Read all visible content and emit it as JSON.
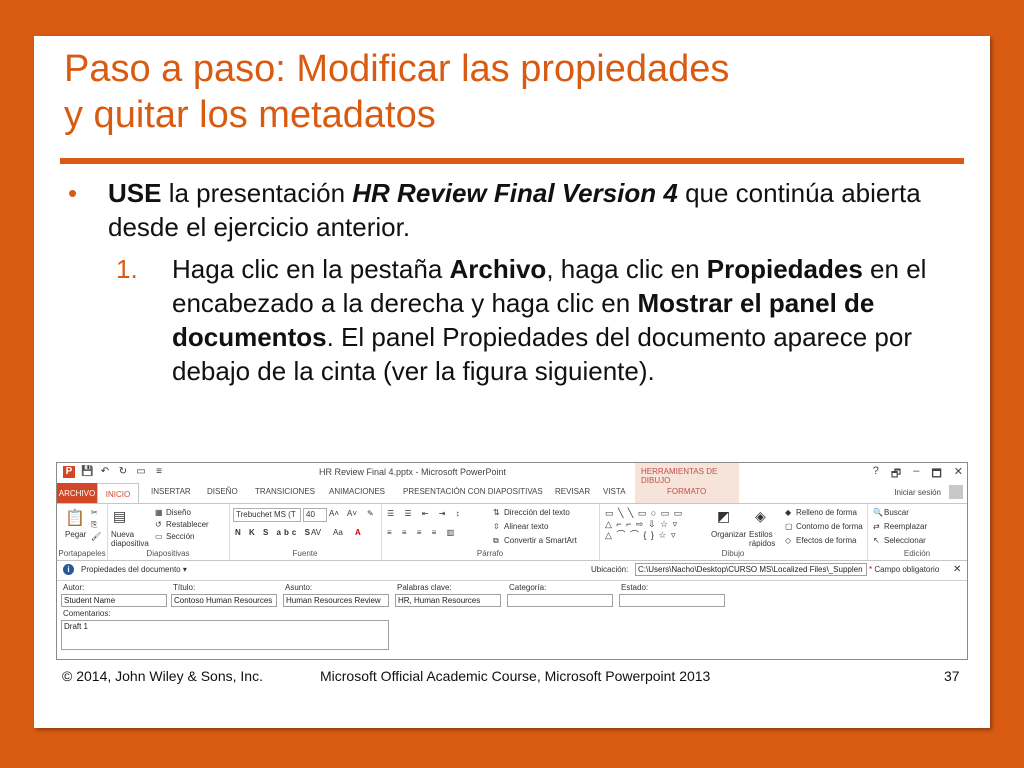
{
  "slide": {
    "title_line1": "Paso a paso: Modificar las propiedades",
    "title_line2": "y quitar los metadatos",
    "bullet": {
      "use": "USE",
      "text1": " la presentación ",
      "doc_name": "HR Review Final Version 4",
      "text2": " que continúa abierta desde el ejercicio anterior."
    },
    "step": {
      "number": "1.",
      "t1": "Haga clic en la pestaña ",
      "b1": "Archivo",
      "t2": ", haga clic en ",
      "b2": "Propiedades",
      "t3": " en el encabezado a la derecha y haga clic en ",
      "b3": "Mostrar el panel de documentos",
      "t4": ". El panel Propiedades del documento aparece por debajo de la cinta (ver la figura siguiente)."
    }
  },
  "screenshot": {
    "window_title": "HR Review Final 4.pptx - Microsoft PowerPoint",
    "context_tab_header": "HERRAMIENTAS DE DIBUJO",
    "window_controls": [
      "?",
      "🗗",
      "–",
      "🗖",
      "✕"
    ],
    "tabs": [
      "ARCHIVO",
      "INICIO",
      "INSERTAR",
      "DISEÑO",
      "TRANSICIONES",
      "ANIMACIONES",
      "PRESENTACIÓN CON DIAPOSITIVAS",
      "REVISAR",
      "VISTA",
      "FORMATO"
    ],
    "signin": "Iniciar sesión",
    "ribbon": {
      "portapapeles": {
        "label": "Portapapeles",
        "pegar": "Pegar"
      },
      "diapositivas": {
        "label": "Diapositivas",
        "nueva": "Nueva diapositiva",
        "diseno": "Diseño",
        "restablecer": "Restablecer",
        "seccion": "Sección"
      },
      "fuente": {
        "label": "Fuente",
        "font_name": "Trebuchet MS (T",
        "font_size": "40",
        "styles": "N K S abc S",
        "spacing": "AV",
        "case": "Aa",
        "color": "A"
      },
      "parrafo": {
        "label": "Párrafo",
        "direccion": "Dirección del texto",
        "alinear": "Alinear texto",
        "smartart": "Convertir a SmartArt"
      },
      "dibujo": {
        "label": "Dibujo",
        "organizar": "Organizar",
        "estilos": "Estilos rápidos",
        "relleno": "Relleno de forma",
        "contorno": "Contorno de forma",
        "efectos": "Efectos de forma"
      },
      "edicion": {
        "label": "Edición",
        "buscar": "Buscar",
        "reemplazar": "Reemplazar",
        "seleccionar": "Seleccionar"
      }
    },
    "panel": {
      "title": "Propiedades del documento",
      "ubicacion_label": "Ubicación:",
      "ubicacion_value": "C:\\Users\\Nacho\\Desktop\\CURSO MS\\Localized Files\\_Supplen",
      "required": "* Campo obligatorio",
      "fields": [
        {
          "label": "Autor:",
          "value": "Student Name"
        },
        {
          "label": "Título:",
          "value": "Contoso Human Resources"
        },
        {
          "label": "Asunto:",
          "value": "Human Resources Review"
        },
        {
          "label": "Palabras clave:",
          "value": "HR, Human Resources"
        },
        {
          "label": "Categoría:",
          "value": ""
        },
        {
          "label": "Estado:",
          "value": ""
        }
      ],
      "comments_label": "Comentarios:",
      "comments_value": "Draft 1"
    }
  },
  "footer": {
    "copyright": "© 2014, John Wiley & Sons, Inc.",
    "course": "Microsoft Official Academic Course, Microsoft Powerpoint 2013",
    "page": "37"
  },
  "colors": {
    "accent": "#d95b12",
    "ppt": "#d24726"
  }
}
